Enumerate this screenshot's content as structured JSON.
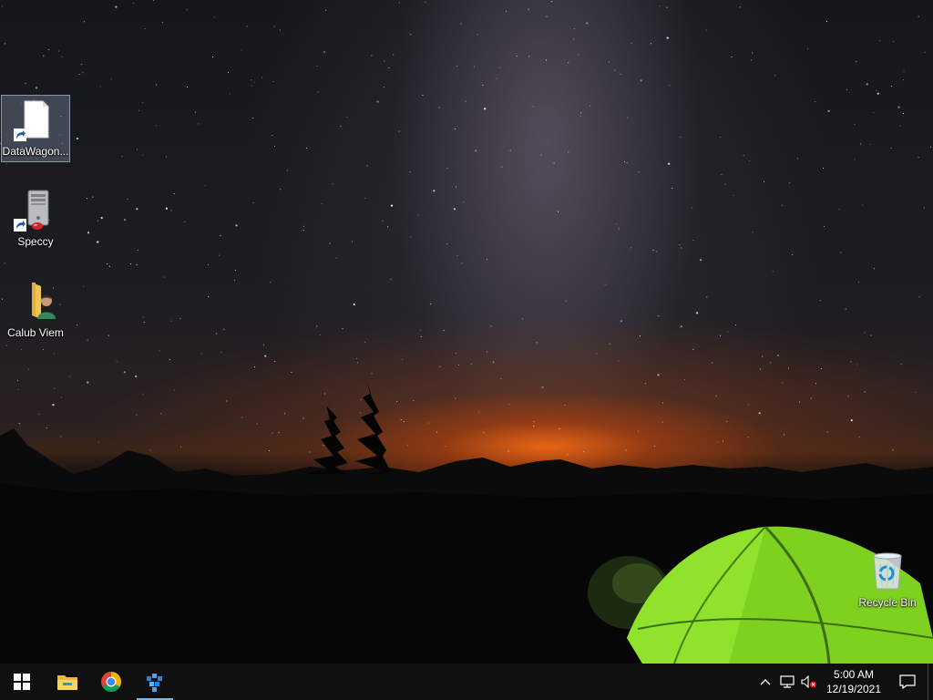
{
  "desktop": {
    "icons": [
      {
        "label": "DataWagon...",
        "icon": "blank-document-icon",
        "shortcut": true
      },
      {
        "label": "Speccy",
        "icon": "computer-tower-icon",
        "shortcut": true
      },
      {
        "label": "Calub Viem",
        "icon": "user-folder-icon",
        "shortcut": false
      },
      {
        "label": "Recycle Bin",
        "icon": "recycle-bin-icon",
        "shortcut": false
      }
    ]
  },
  "taskbar": {
    "apps": [
      {
        "icon": "windows-start-icon",
        "active": false
      },
      {
        "icon": "file-explorer-icon",
        "active": false
      },
      {
        "icon": "chrome-icon",
        "active": false
      },
      {
        "icon": "app-icon",
        "active": true
      }
    ],
    "tray": {
      "icons": [
        "chevron-up-icon",
        "network-icon",
        "volume-muted-icon"
      ],
      "time": "5:00 AM",
      "date": "12/19/2021"
    }
  }
}
